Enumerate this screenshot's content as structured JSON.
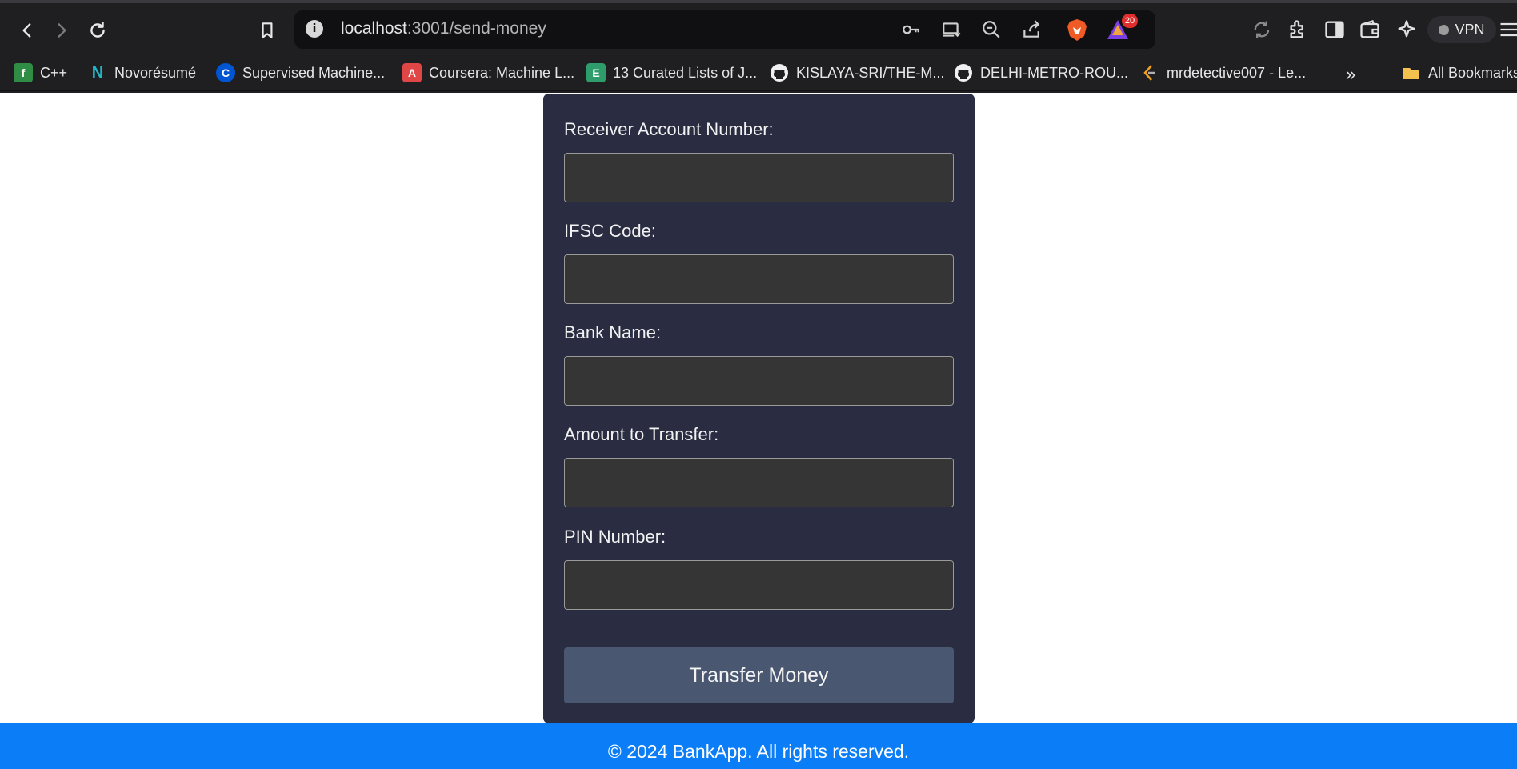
{
  "browser": {
    "url_host": "localhost",
    "url_path": ":3001/send-money",
    "rewards_badge": "20",
    "vpn_label": "VPN"
  },
  "bookmarks": [
    {
      "label": "C++",
      "icon": "gfg-icon",
      "color": "#2f8d46",
      "glyph": "f"
    },
    {
      "label": "Novorésumé",
      "icon": "novoresume-icon",
      "color": "#1f1f22",
      "glyph": "N"
    },
    {
      "label": "Supervised Machine...",
      "icon": "coursera-icon",
      "color": "#0056d2",
      "glyph": "C"
    },
    {
      "label": "Coursera: Machine L...",
      "icon": "bookmark-site-icon",
      "color": "#e04646",
      "glyph": "A"
    },
    {
      "label": "13 Curated Lists of J...",
      "icon": "list-icon",
      "color": "#2e9d6b",
      "glyph": "E"
    },
    {
      "label": "KISLAYA-SRI/THE-M...",
      "icon": "github-icon",
      "color": "#1f1f22",
      "glyph": ""
    },
    {
      "label": "DELHI-METRO-ROU...",
      "icon": "github-icon",
      "color": "#1f1f22",
      "glyph": ""
    },
    {
      "label": "mrdetective007 - Le...",
      "icon": "leetcode-icon",
      "color": "#1f1f22",
      "glyph": ""
    }
  ],
  "all_bookmarks_label": "All Bookmarks",
  "form": {
    "receiver_label": "Receiver Account Number:",
    "ifsc_label": "IFSC Code:",
    "bank_label": "Bank Name:",
    "amount_label": "Amount to Transfer:",
    "pin_label": "PIN Number:",
    "submit_label": "Transfer Money"
  },
  "footer": {
    "text": "© 2024 BankApp. All rights reserved."
  },
  "colors": {
    "card_bg": "#2a2d42",
    "input_bg": "#353535",
    "button_bg": "#4a5771",
    "footer_bg": "#0a7df7"
  }
}
